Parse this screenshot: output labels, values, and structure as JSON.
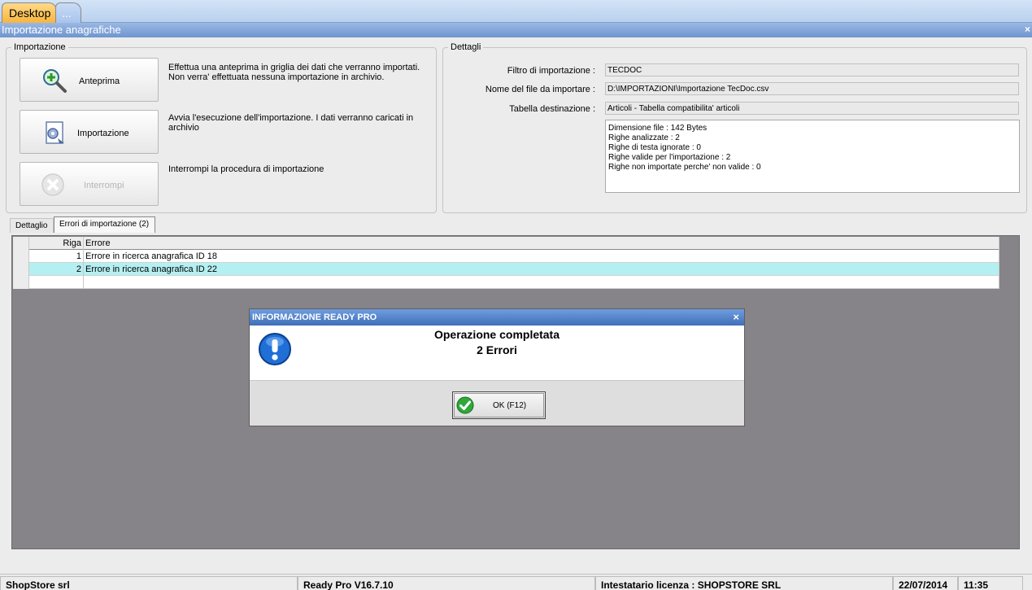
{
  "tabs": {
    "desktop": "Desktop",
    "more": "..."
  },
  "window": {
    "title": "Importazione anagrafiche",
    "close": "×"
  },
  "import_group": {
    "legend": "Importazione",
    "buttons": [
      {
        "label": "Anteprima",
        "desc": "Effettua una anteprima in griglia dei dati che verranno importati. Non verra' effettuata nessuna importazione in archivio."
      },
      {
        "label": "Importazione",
        "desc": "Avvia l'esecuzione dell'importazione. I dati verranno caricati in archivio"
      },
      {
        "label": "Interrompi",
        "desc": "Interrompi la procedura di importazione"
      }
    ]
  },
  "details_group": {
    "legend": "Dettagli",
    "filter_label": "Filtro di importazione :",
    "filter_value": "TECDOC",
    "file_label": "Nome del file da importare :",
    "file_value": "D:\\IMPORTAZIONI\\Importazione TecDoc.csv",
    "table_label": "Tabella destinazione :",
    "table_value": "Articoli - Tabella compatibilita' articoli",
    "info_lines": [
      "Dimensione file : 142 Bytes",
      "Righe analizzate : 2",
      "Righe di testa ignorate : 0",
      "Righe valide per l'importazione : 2",
      "Righe non importate perche' non valide : 0"
    ]
  },
  "subtabs": [
    "Dettaglio",
    "Errori di importazione (2)"
  ],
  "grid": {
    "columns": [
      "Riga",
      "Errore"
    ],
    "rows": [
      {
        "riga": "1",
        "errore": "Errore in ricerca anagrafica ID 18"
      },
      {
        "riga": "2",
        "errore": "Errore in ricerca anagrafica ID 22"
      }
    ]
  },
  "dialog": {
    "title": "INFORMAZIONE READY PRO",
    "close": "×",
    "line1": "Operazione completata",
    "line2": "2 Errori",
    "ok_label": "OK (F12)"
  },
  "status": {
    "company": "ShopStore srl",
    "version": "Ready Pro V16.7.10",
    "license": "Intestatario licenza : SHOPSTORE SRL",
    "date": "22/07/2014",
    "time": "11:35"
  },
  "colors": {
    "accent": "#6e95cf",
    "selected_row": "#b4f0f2",
    "grid_bg": "#868488"
  },
  "icons": [
    "search-plus-icon",
    "import-gear-icon",
    "stop-icon",
    "info-exclamation-icon",
    "check-icon"
  ]
}
